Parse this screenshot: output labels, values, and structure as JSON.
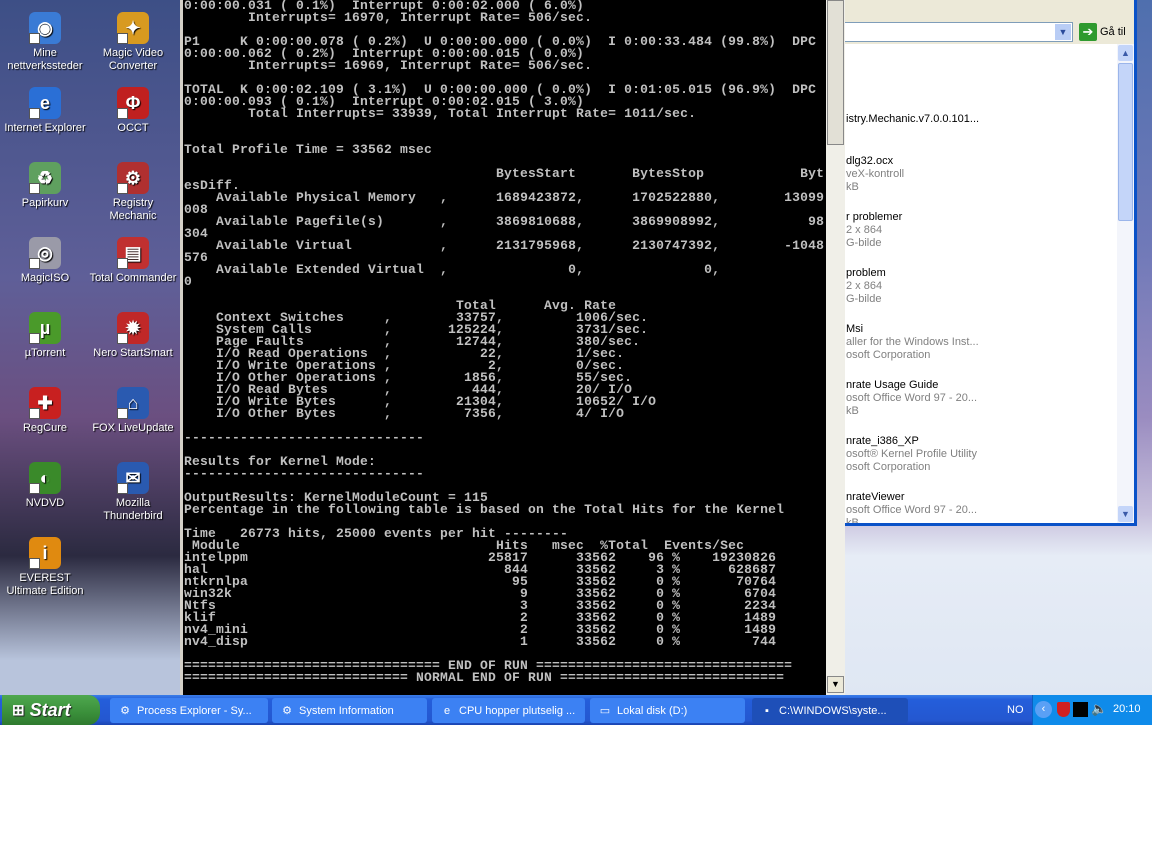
{
  "desktop_icons": [
    {
      "label": "Mine nettverkssteder",
      "icon": "network-places-icon",
      "glyph": "◉",
      "color": "#3a7bd5"
    },
    {
      "label": "Magic Video Converter",
      "icon": "magic-video-converter-icon",
      "glyph": "✦",
      "color": "#d89a20"
    },
    {
      "label": "Internet Explorer",
      "icon": "internet-explorer-icon",
      "glyph": "e",
      "color": "#2a6fd6"
    },
    {
      "label": "OCCT",
      "icon": "occt-icon",
      "glyph": "Φ",
      "color": "#c02020"
    },
    {
      "label": "Papirkurv",
      "icon": "recycle-bin-icon",
      "glyph": "♻",
      "color": "#5fa05f"
    },
    {
      "label": "Registry Mechanic",
      "icon": "registry-mechanic-icon",
      "glyph": "⚙",
      "color": "#b03030"
    },
    {
      "label": "MagicISO",
      "icon": "magiciso-icon",
      "glyph": "◎",
      "color": "#9a9aa8"
    },
    {
      "label": "Total Commander",
      "icon": "total-commander-icon",
      "glyph": "▤",
      "color": "#c03030"
    },
    {
      "label": "µTorrent",
      "icon": "utorrent-icon",
      "glyph": "µ",
      "color": "#4a9a2a"
    },
    {
      "label": "Nero StartSmart",
      "icon": "nero-startsmart-icon",
      "glyph": "✹",
      "color": "#c02828"
    },
    {
      "label": "RegCure",
      "icon": "regcure-icon",
      "glyph": "✚",
      "color": "#c82020"
    },
    {
      "label": "FOX LiveUpdate",
      "icon": "fox-liveupdate-icon",
      "glyph": "⌂",
      "color": "#2a5ab0"
    },
    {
      "label": "NVDVD",
      "icon": "nvdvd-icon",
      "glyph": "◐",
      "color": "#3a8a2a"
    },
    {
      "label": "Mozilla Thunderbird",
      "icon": "thunderbird-icon",
      "glyph": "✉",
      "color": "#2a5ab0"
    },
    {
      "label": "EVEREST Ultimate Edition",
      "icon": "everest-icon",
      "glyph": "i",
      "color": "#e08a10"
    }
  ],
  "console": {
    "header_lines": [
      "0:00:00.031 ( 0.1%)  Interrupt 0:00:02.000 ( 6.0%)",
      "        Interrupts= 16970, Interrupt Rate= 506/sec.",
      "",
      "P1     K 0:00:00.078 ( 0.2%)  U 0:00:00.000 ( 0.0%)  I 0:00:33.484 (99.8%)  DPC",
      "0:00:00.062 ( 0.2%)  Interrupt 0:00:00.015 ( 0.0%)",
      "        Interrupts= 16969, Interrupt Rate= 506/sec.",
      "",
      "TOTAL  K 0:00:02.109 ( 3.1%)  U 0:00:00.000 ( 0.0%)  I 0:01:05.015 (96.9%)  DPC",
      "0:00:00.093 ( 0.1%)  Interrupt 0:00:02.015 ( 3.0%)",
      "        Total Interrupts= 33939, Total Interrupt Rate= 1011/sec.",
      "",
      "",
      "Total Profile Time = 33562 msec",
      ""
    ],
    "memory_headers": [
      "BytesStart",
      "BytesStop",
      "BytesDiff."
    ],
    "memory_rows": [
      {
        "name": "Available Physical Memory",
        "start": "1689423872",
        "stop": "1702522880",
        "diff": "13099008"
      },
      {
        "name": "Available Pagefile(s)",
        "start": "3869810688",
        "stop": "3869908992",
        "diff": "98304"
      },
      {
        "name": "Available Virtual",
        "start": "2131795968",
        "stop": "2130747392",
        "diff": "-1048576"
      },
      {
        "name": "Available Extended Virtual",
        "start": "0",
        "stop": "0",
        "diff": "0"
      }
    ],
    "stats_headers": [
      "Total",
      "Avg. Rate"
    ],
    "stats_rows": [
      {
        "name": "Context Switches",
        "total": "33757",
        "rate": "1006/sec."
      },
      {
        "name": "System Calls",
        "total": "125224",
        "rate": "3731/sec."
      },
      {
        "name": "Page Faults",
        "total": "12744",
        "rate": "380/sec."
      },
      {
        "name": "I/O Read Operations",
        "total": "22",
        "rate": "1/sec."
      },
      {
        "name": "I/O Write Operations",
        "total": "2",
        "rate": "0/sec."
      },
      {
        "name": "I/O Other Operations",
        "total": "1856",
        "rate": "55/sec."
      },
      {
        "name": "I/O Read Bytes",
        "total": "444",
        "rate": "20/ I/O"
      },
      {
        "name": "I/O Write Bytes",
        "total": "21304",
        "rate": "10652/ I/O"
      },
      {
        "name": "I/O Other Bytes",
        "total": "7356",
        "rate": "4/ I/O"
      }
    ],
    "mid_lines": [
      "",
      "------------------------------",
      "",
      "Results for Kernel Mode:",
      "------------------------------",
      "",
      "OutputResults: KernelModuleCount = 115",
      "Percentage in the following table is based on the Total Hits for the Kernel",
      "",
      "Time   26773 hits, 25000 events per hit --------"
    ],
    "module_headers": [
      "Module",
      "Hits",
      "msec",
      "%Total",
      "Events/Sec"
    ],
    "module_rows": [
      {
        "name": "intelppm",
        "hits": "25817",
        "msec": "33562",
        "pct": "96",
        "events": "19230826"
      },
      {
        "name": "hal",
        "hits": "844",
        "msec": "33562",
        "pct": "3",
        "events": "628687"
      },
      {
        "name": "ntkrnlpa",
        "hits": "95",
        "msec": "33562",
        "pct": "0",
        "events": "70764"
      },
      {
        "name": "win32k",
        "hits": "9",
        "msec": "33562",
        "pct": "0",
        "events": "6704"
      },
      {
        "name": "Ntfs",
        "hits": "3",
        "msec": "33562",
        "pct": "0",
        "events": "2234"
      },
      {
        "name": "klif",
        "hits": "2",
        "msec": "33562",
        "pct": "0",
        "events": "1489"
      },
      {
        "name": "nv4_mini",
        "hits": "2",
        "msec": "33562",
        "pct": "0",
        "events": "1489"
      },
      {
        "name": "nv4_disp",
        "hits": "1",
        "msec": "33562",
        "pct": "0",
        "events": "744"
      }
    ],
    "footer_lines": [
      "",
      "================================ END OF RUN ================================",
      "============================ NORMAL END OF RUN ============================"
    ]
  },
  "explorer": {
    "goto_label": "Gå til",
    "items": [
      {
        "lines": [
          "istry.Mechanic.v7.0.0.101..."
        ]
      },
      {
        "lines": [
          "dlg32.ocx",
          "veX-kontroll",
          " kB"
        ]
      },
      {
        "lines": [
          "r problemer",
          "2 x 864",
          "G-bilde"
        ]
      },
      {
        "lines": [
          "problem",
          "2 x 864",
          "G-bilde"
        ]
      },
      {
        "lines": [
          "Msi",
          "aller for the Windows Inst...",
          "osoft Corporation"
        ]
      },
      {
        "lines": [
          "nrate Usage Guide",
          "osoft Office Word 97 - 20...",
          " kB"
        ]
      },
      {
        "lines": [
          "nrate_i386_XP",
          "osoft® Kernel Profile Utility",
          "osoft Corporation"
        ]
      },
      {
        "lines": [
          "nrateViewer",
          "osoft Office Word 97 - 20...",
          "kB"
        ]
      }
    ]
  },
  "taskbar": {
    "start_label": "Start",
    "tasks": [
      {
        "label": "Process Explorer - Sy...",
        "icon": "process-explorer-icon",
        "glyph": "⚙",
        "active": false
      },
      {
        "label": "System Information",
        "icon": "system-information-icon",
        "glyph": "⚙",
        "active": false
      },
      {
        "label": "CPU hopper plutselig ...",
        "icon": "internet-explorer-icon",
        "glyph": "e",
        "active": false
      },
      {
        "label": "Lokal disk (D:)",
        "icon": "drive-icon",
        "glyph": "▭",
        "active": false
      },
      {
        "label": "C:\\WINDOWS\\syste...",
        "icon": "command-prompt-icon",
        "glyph": "▪",
        "active": true
      }
    ],
    "language": "NO",
    "clock": "20:10"
  }
}
